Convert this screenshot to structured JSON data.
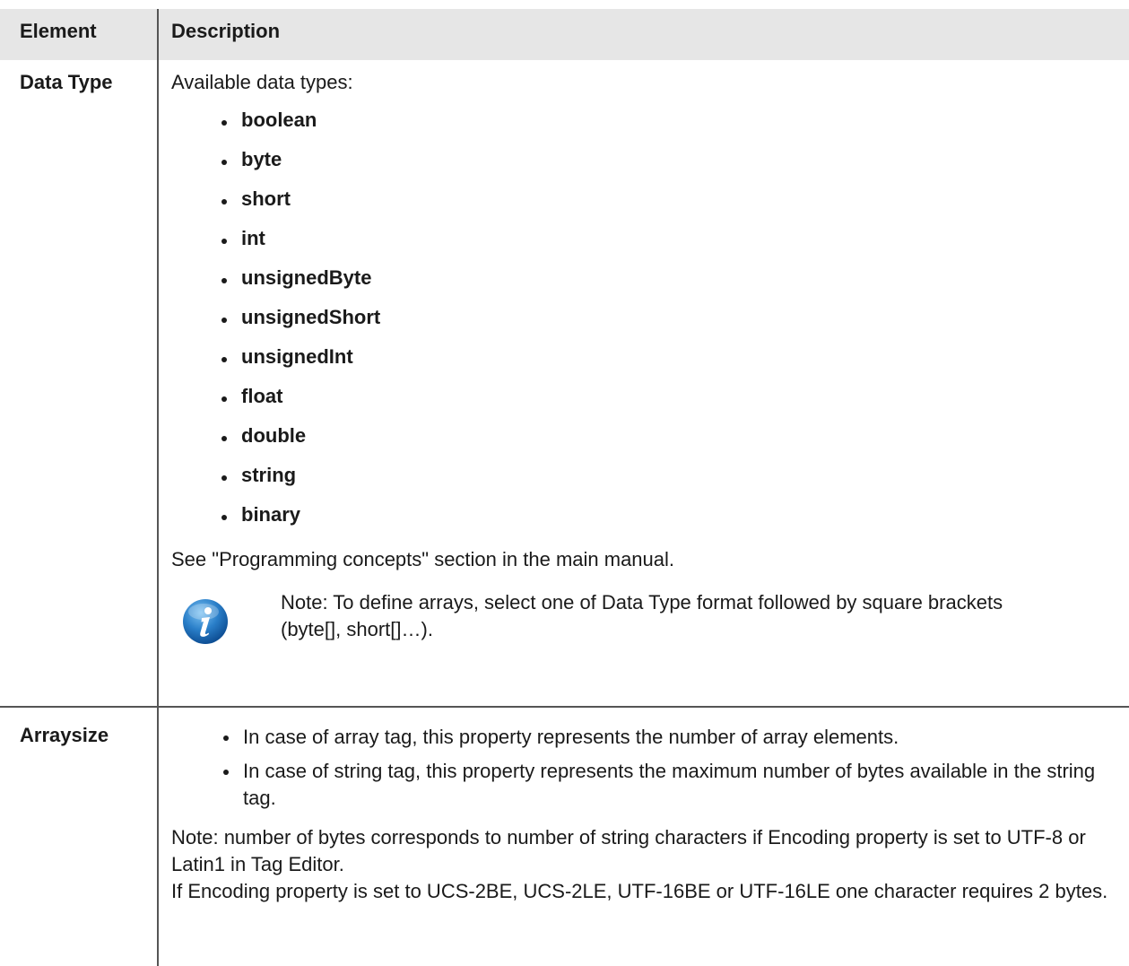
{
  "header": {
    "element": "Element",
    "description": "Description"
  },
  "rows": [
    {
      "element": "Data Type",
      "intro": "Available data types:",
      "types": [
        "boolean",
        "byte",
        "short",
        "int",
        "unsignedByte",
        "unsignedShort",
        "unsignedInt",
        "float",
        "double",
        "string",
        "binary"
      ],
      "see": "See \"Programming concepts\" section in the main manual.",
      "note": "Note: To define arrays, select one of Data Type format followed by square brackets (byte[], short[]…)."
    },
    {
      "element": "Arraysize",
      "bullets": [
        "In case of array tag, this property represents the number of array elements.",
        "In case of string tag, this property represents the maximum number of bytes available in the string tag."
      ],
      "note_lines": [
        "Note: number of bytes corresponds to number of string characters if Encoding property is set to UTF-8 or Latin1 in Tag Editor.",
        "If Encoding property is set to UCS-2BE, UCS-2LE, UTF-16BE or UTF-16LE one character requires 2 bytes."
      ]
    }
  ],
  "colors": {
    "header_bg": "#e6e6e6",
    "border": "#555555",
    "icon_blue": "#2a7fc9"
  }
}
